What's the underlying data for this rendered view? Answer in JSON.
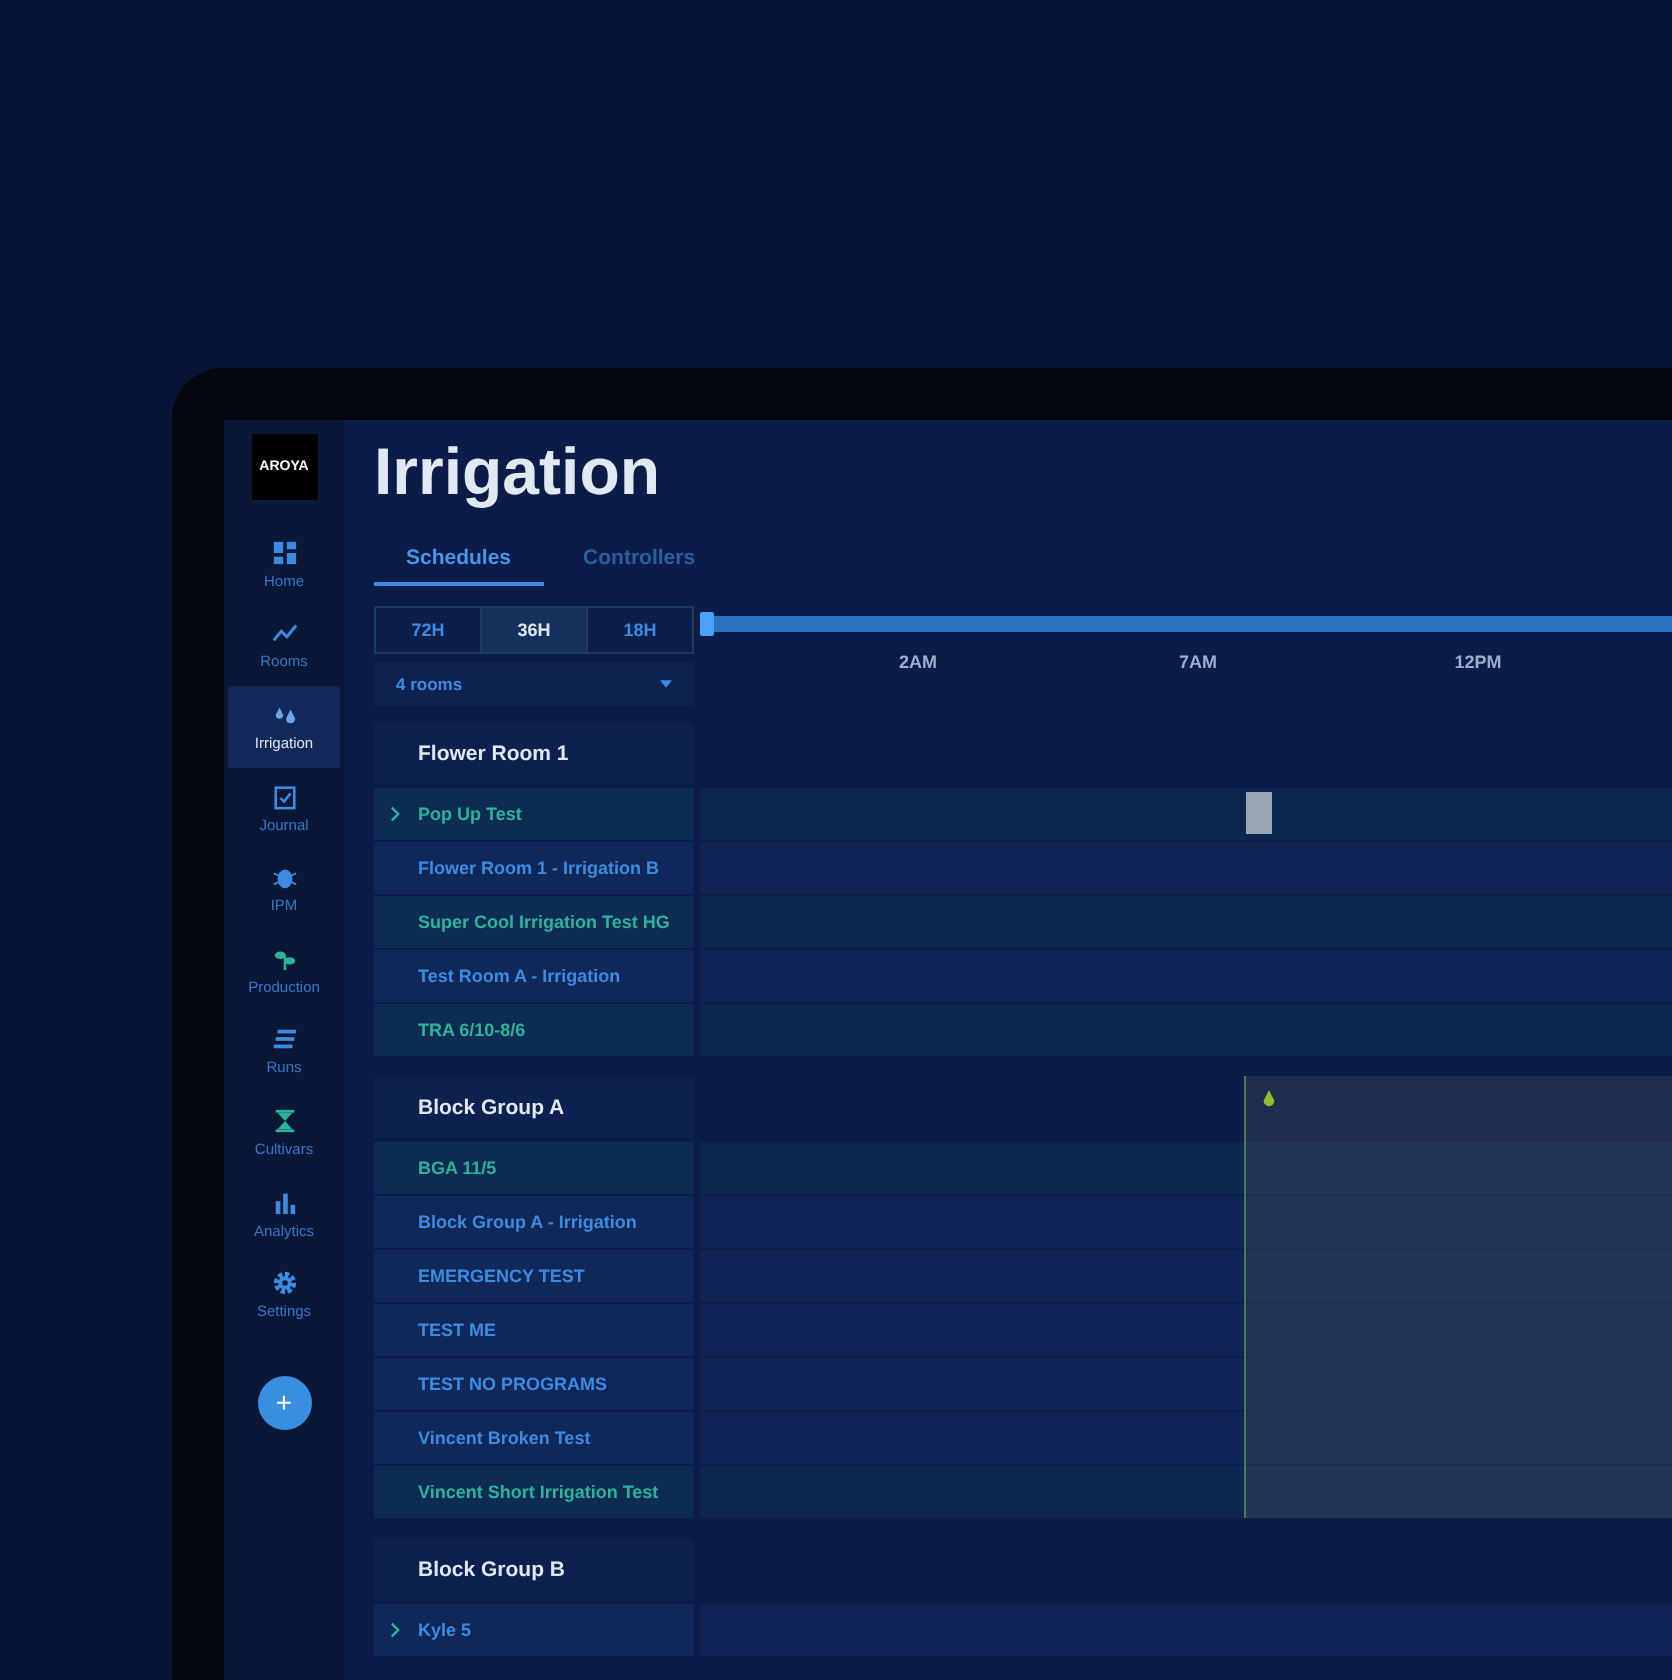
{
  "sidebar": {
    "logo": "AROYA",
    "nav": [
      {
        "label": "Home",
        "selected": false
      },
      {
        "label": "Rooms",
        "selected": false
      },
      {
        "label": "Irrigation",
        "selected": true
      },
      {
        "label": "Journal",
        "selected": false
      },
      {
        "label": "IPM",
        "selected": false
      },
      {
        "label": "Production",
        "selected": false
      },
      {
        "label": "Runs",
        "selected": false
      },
      {
        "label": "Cultivars",
        "selected": false
      },
      {
        "label": "Analytics",
        "selected": false
      },
      {
        "label": "Settings",
        "selected": false
      }
    ],
    "add_button": "+"
  },
  "page": {
    "title": "Irrigation",
    "tabs": [
      {
        "label": "Schedules",
        "selected": true
      },
      {
        "label": "Controllers",
        "selected": false
      }
    ],
    "ranges": [
      {
        "label": "72H",
        "selected": false
      },
      {
        "label": "36H",
        "selected": true
      },
      {
        "label": "18H",
        "selected": false
      }
    ],
    "room_filter": {
      "value": "4 rooms"
    },
    "time_labels": [
      "2AM",
      "7AM",
      "12PM"
    ],
    "groups": [
      {
        "name": "Flower Room 1",
        "highlighted": false,
        "schedules": [
          {
            "name": "Pop Up Test",
            "color": "#2bb39b",
            "expandable": true,
            "event": true
          },
          {
            "name": "Flower Room 1 - Irrigation B",
            "color": "#3d8be0",
            "expandable": false,
            "event": false
          },
          {
            "name": "Super Cool Irrigation Test HG",
            "color": "#2bb39b",
            "expandable": false,
            "event": false
          },
          {
            "name": "Test Room A - Irrigation",
            "color": "#3d8be0",
            "expandable": false,
            "event": false
          },
          {
            "name": "TRA 6/10-8/6",
            "color": "#2bb39b",
            "expandable": false,
            "event": false
          }
        ]
      },
      {
        "name": "Block Group A",
        "highlighted": true,
        "schedules": [
          {
            "name": "BGA 11/5",
            "color": "#2bb39b",
            "expandable": false,
            "event": false
          },
          {
            "name": "Block Group A - Irrigation",
            "color": "#3d8be0",
            "expandable": false,
            "event": false
          },
          {
            "name": "EMERGENCY TEST",
            "color": "#3d8be0",
            "expandable": false,
            "event": false
          },
          {
            "name": "TEST ME",
            "color": "#3d8be0",
            "expandable": false,
            "event": false
          },
          {
            "name": "TEST NO PROGRAMS",
            "color": "#3d8be0",
            "expandable": false,
            "event": false
          },
          {
            "name": "Vincent Broken Test",
            "color": "#3d8be0",
            "expandable": false,
            "event": false
          },
          {
            "name": "Vincent Short Irrigation Test",
            "color": "#2bb39b",
            "expandable": false,
            "event": false
          }
        ]
      },
      {
        "name": "Block Group B",
        "highlighted": false,
        "schedules": [
          {
            "name": "Kyle 5",
            "color": "#3d8be0",
            "expandable": true,
            "event": false
          }
        ]
      }
    ]
  }
}
